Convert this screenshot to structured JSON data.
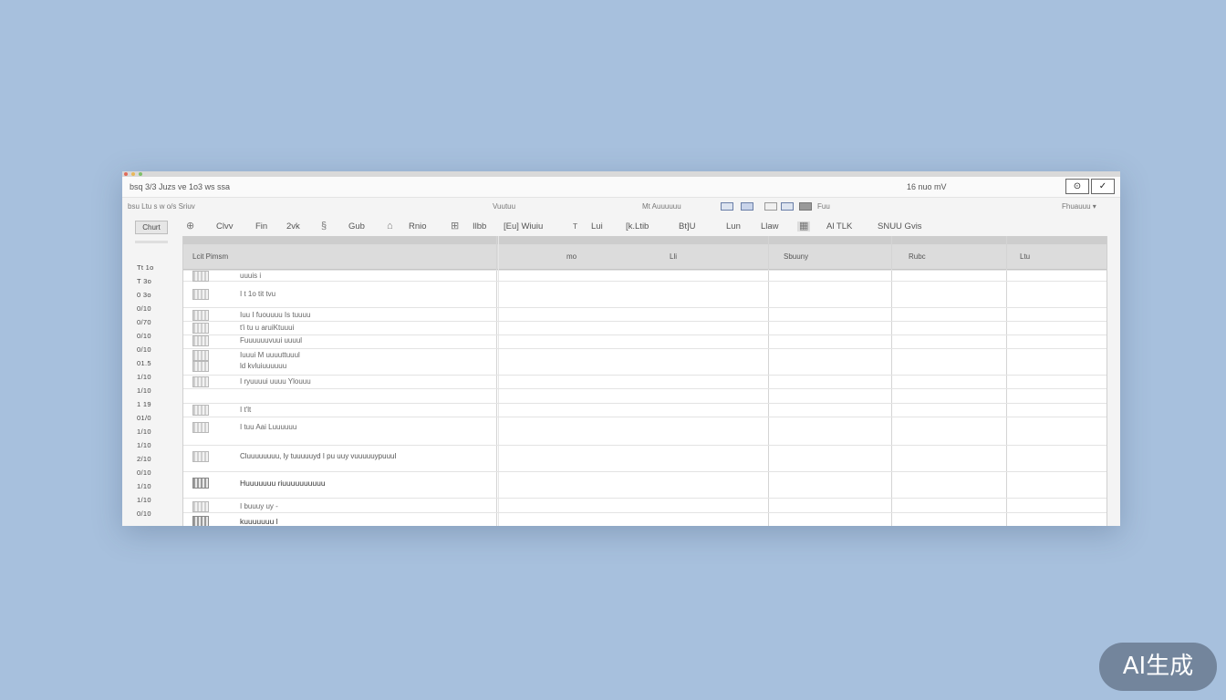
{
  "menubar": {
    "app_name": "bsq 3/3  Juzs ve 1o3 ws ssa",
    "zoom": "16 nuo mV",
    "minimize_glyph": "⊙",
    "check_glyph": "✓"
  },
  "subbar": {
    "left": "bsu  Ltu  s   w  o/s    Sriuv",
    "center": "Vuutuu",
    "format_label": "Mt  Auuuuuu",
    "right_small": "Fuu",
    "right": "Fhuauuu ▾"
  },
  "toolbar": {
    "chart_button": "Churt",
    "tools": [
      {
        "icon": "⊕",
        "label": "Clvv"
      },
      {
        "icon": "",
        "label": "Fin"
      },
      {
        "icon": "",
        "label": "2vk"
      },
      {
        "icon": "§",
        "label": "Gub"
      },
      {
        "icon": "⌂",
        "label": "Rnio"
      },
      {
        "icon": "⊞",
        "label": "Ilbb"
      },
      {
        "icon": "",
        "label": "[Eu] Wiuiu"
      },
      {
        "icon": "ᴛ",
        "label": "Lui"
      },
      {
        "icon": "",
        "label": "[k.Ltib"
      },
      {
        "icon": "",
        "label": "Bt]U"
      },
      {
        "icon": "",
        "label": "Lun"
      },
      {
        "icon": "",
        "label": "Llaw"
      },
      {
        "icon": "",
        "label": "Al TLK"
      },
      {
        "icon": "",
        "label": "SNUU  Gvis"
      }
    ]
  },
  "grid": {
    "headers": [
      "Lcit  Pimsm",
      "mo",
      "Lli",
      "Sbuuny",
      "Rubc",
      "Ltu"
    ],
    "rows": [
      {
        "text": "uuuis i",
        "style": "normal"
      },
      {
        "text": "I t  1o tit tvu",
        "style": "normal"
      },
      {
        "text": "Iuu I fuouuuu Is tuuuu",
        "style": "normal"
      },
      {
        "text": "t'i tu u aruiKtuuui",
        "style": "normal"
      },
      {
        "text": "Fuuuuuuvuui uuuul",
        "style": "normal"
      },
      {
        "text": "Iuuui M  uuuuttuuul",
        "style": "normal"
      },
      {
        "text": "ld  kvluiuuuuuu",
        "style": "normal"
      },
      {
        "text": "I ryuuuui uuuu Ylouuu",
        "style": "normal"
      },
      {
        "text": "I  t'lt",
        "style": "normal"
      },
      {
        "text": "I tuu   Aai Luuuuuu",
        "style": "normal"
      },
      {
        "text": "Cluuuuuuuu, ly tuuuuuyd I  pu uuy vuuuuuypuuuI",
        "style": "mid"
      },
      {
        "text": "Huuuuuuu  riuuuuuuuuuu",
        "style": "strong"
      },
      {
        "text": "I   buuuy   uy  -",
        "style": "normal"
      },
      {
        "text": "kuuuuuuu l",
        "style": "strong"
      }
    ],
    "row_numbers": [
      "Tt 1o",
      "T 3o",
      "0 3o",
      "0/10",
      "0/70",
      "0/10",
      "0/10",
      "01.5",
      "1/10",
      "1/10",
      "1 19",
      "01/0",
      "1/10",
      "1/10",
      "2/10",
      "0/10",
      "1/10",
      "1/10",
      "0/10"
    ]
  },
  "watermark": "AI生成"
}
